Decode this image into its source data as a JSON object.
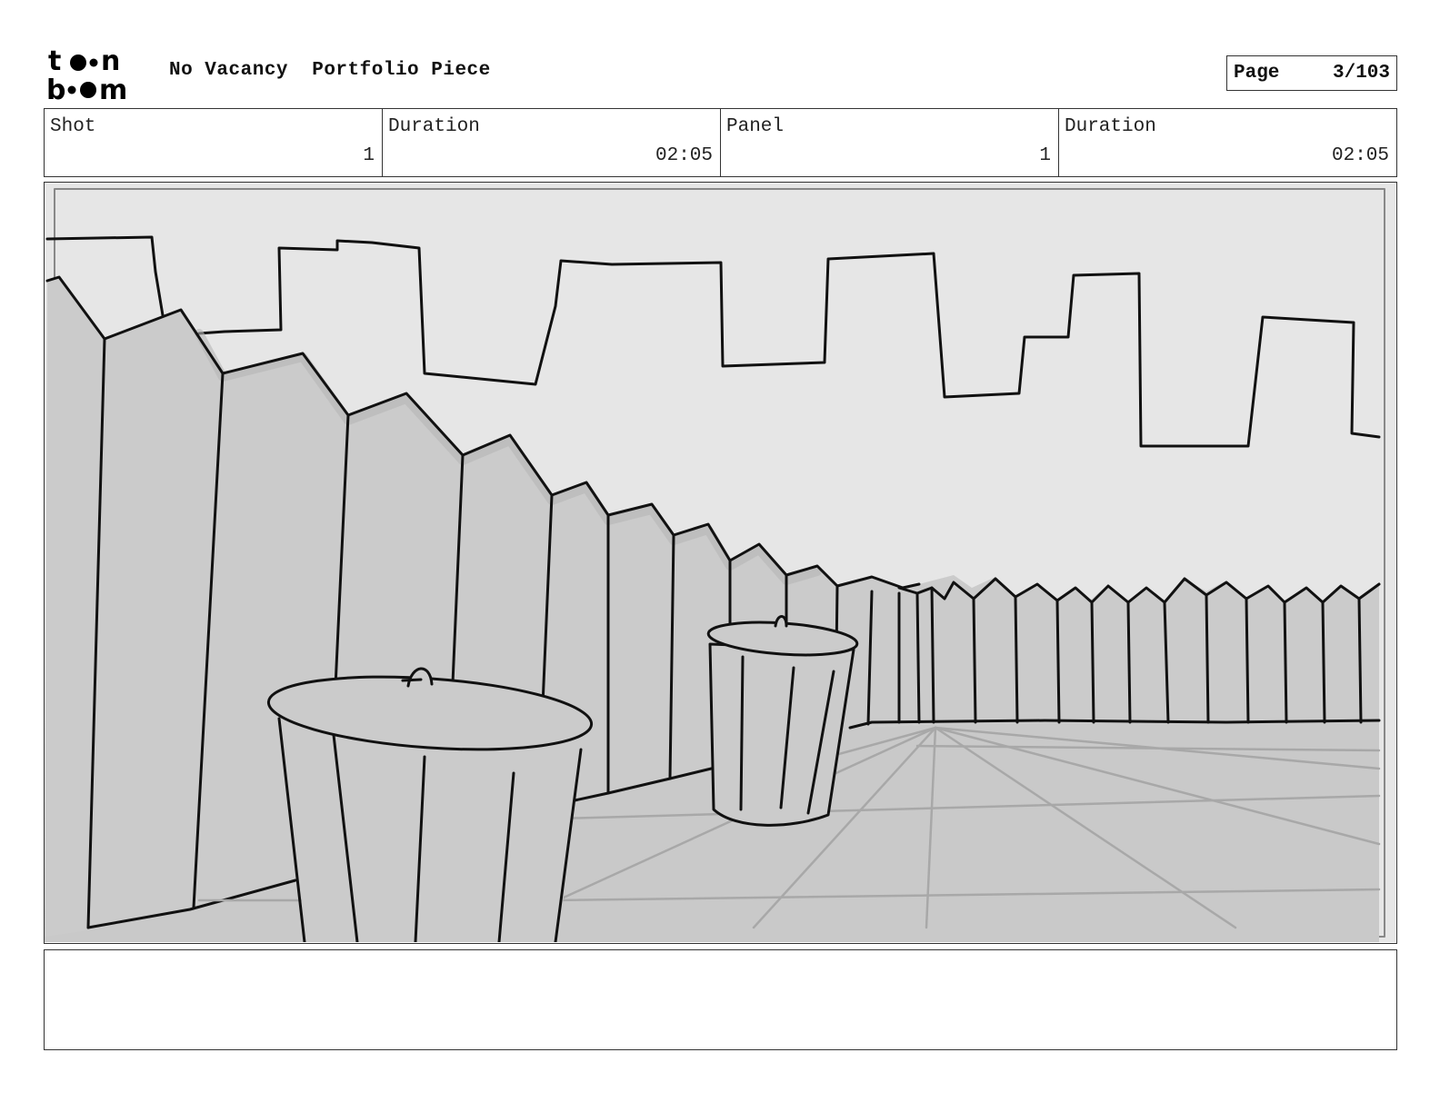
{
  "header": {
    "logo_text": "toon boom",
    "title": "No Vacancy  Portfolio Piece",
    "page_label": "Page",
    "page_number": "3/103"
  },
  "info": {
    "shot_label": "Shot",
    "shot_value": "1",
    "shot_duration_label": "Duration",
    "shot_duration_value": "02:05",
    "panel_label": "Panel",
    "panel_value": "1",
    "panel_duration_label": "Duration",
    "panel_duration_value": "02:05"
  },
  "notes": {
    "text": ""
  },
  "colors": {
    "sky": "#e6e6e6",
    "fence": "#cbcbcb",
    "ground": "#c9c9c9",
    "ink": "#111111",
    "guide": "#a8a8a8"
  }
}
